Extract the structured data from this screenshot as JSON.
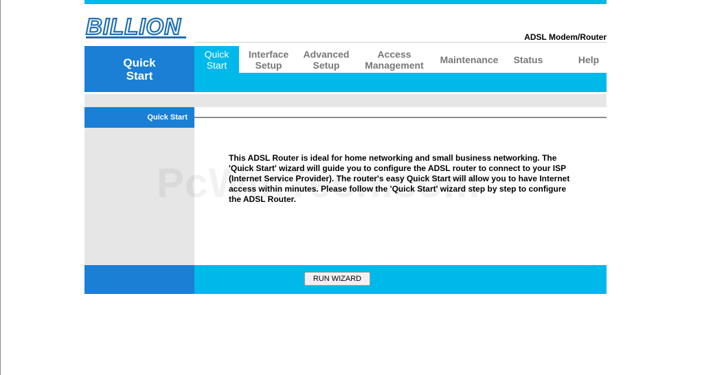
{
  "brand": {
    "logo_text": "BILLION",
    "product_name": "ADSL Modem/Router"
  },
  "page_header": {
    "title": "Quick Start"
  },
  "nav": {
    "items": [
      {
        "label": "Quick Start",
        "active": true
      },
      {
        "label": "Interface Setup"
      },
      {
        "label": "Advanced Setup"
      },
      {
        "label": "Access Management"
      },
      {
        "label": "Maintenance"
      },
      {
        "label": "Status"
      },
      {
        "label": "Help"
      }
    ]
  },
  "section": {
    "label": "Quick Start"
  },
  "content": {
    "intro_text": "This ADSL Router is ideal for home networking and small business networking. The 'Quick Start' wizard will guide you to configure the ADSL router to connect to your ISP (Internet Service Provider). The router's easy Quick Start will allow you to have Internet access within minutes. Please follow the 'Quick Start' wizard step by step to configure the ADSL Router."
  },
  "watermark": "PcWinTech.com",
  "actions": {
    "run_wizard_label": "RUN WIZARD"
  },
  "colors": {
    "primary_blue": "#1a7fd5",
    "accent_cyan": "#00b9eb",
    "logo_blue": "#1f6fb5",
    "panel_gray": "#e6e6e6"
  }
}
